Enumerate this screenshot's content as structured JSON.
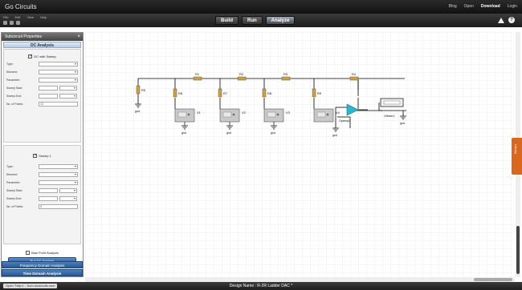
{
  "app": {
    "title": "Go Circuits"
  },
  "top_links": [
    "Blog",
    "Open",
    "Download",
    "Login"
  ],
  "menu": [
    "File",
    "Edit",
    "View",
    "Help"
  ],
  "modes": {
    "build": "Build",
    "run": "Run",
    "analyze": "Analyze"
  },
  "panel": {
    "title": "Subcircuit Properties",
    "close": "×",
    "dc_section": "DC Analysis",
    "dc_sweep_label": "DC with Sweep",
    "sweep1_label": "Sweep 1",
    "fields1": [
      {
        "label": "Type:",
        "value": ""
      },
      {
        "label": "Element:",
        "value": ""
      },
      {
        "label": "Parameter:",
        "value": ""
      },
      {
        "label": "Sweep Start:",
        "value": ""
      },
      {
        "label": "Sweep End:",
        "value": ""
      },
      {
        "label": "No. of Points:",
        "value": "10"
      }
    ],
    "fields2": [
      {
        "label": "Type:",
        "value": ""
      },
      {
        "label": "Element:",
        "value": ""
      },
      {
        "label": "Parameter:",
        "value": ""
      },
      {
        "label": "Sweep Start:",
        "value": ""
      },
      {
        "label": "Sweep End:",
        "value": ""
      },
      {
        "label": "No. of Points:",
        "value": "5"
      }
    ],
    "bias_label": "Bias Point Analysis",
    "run_button": "Run DC Analysis",
    "tab1": "Frequency Domain Analysis",
    "tab2": "Time Domain Analysis"
  },
  "circuit": {
    "top_resistors": [
      "R1",
      "R2",
      "R3",
      "R4"
    ],
    "shunt_resistors": [
      "R5",
      "R6",
      "R7",
      "R8",
      "R9"
    ],
    "sources": [
      "V1",
      "V2",
      "V3",
      "V4"
    ],
    "grounds": [
      "gnd",
      "gnd",
      "gnd",
      "gnd",
      "gnd",
      "gnd",
      "gnd"
    ],
    "opamp": "Opamp1",
    "meter": "VMeter1"
  },
  "side_tab": "Library",
  "status": {
    "url": "Open \"http://... from docircuits.com",
    "design_name": "Design Name : R-2R Ladder DAC *"
  }
}
